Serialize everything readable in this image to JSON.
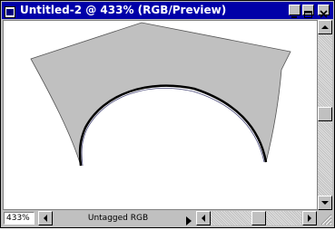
{
  "window": {
    "title": "Untitled-2 @ 433% (RGB/Preview)",
    "colors": {
      "titlebar": "#0000a8",
      "shape_fill": "#c0c0c0",
      "curve_stroke": "#000000"
    }
  },
  "statusbar": {
    "zoom": "433%",
    "profile": "Untagged RGB"
  },
  "icons": {
    "document": "document-icon",
    "minimize": "minimize-icon",
    "maximize": "maximize-icon",
    "close": "close-icon",
    "scroll_up": "arrow-up-icon",
    "scroll_down": "arrow-down-icon",
    "scroll_left": "arrow-left-icon",
    "scroll_right": "arrow-right-icon",
    "profile_menu": "triangle-right-icon"
  }
}
